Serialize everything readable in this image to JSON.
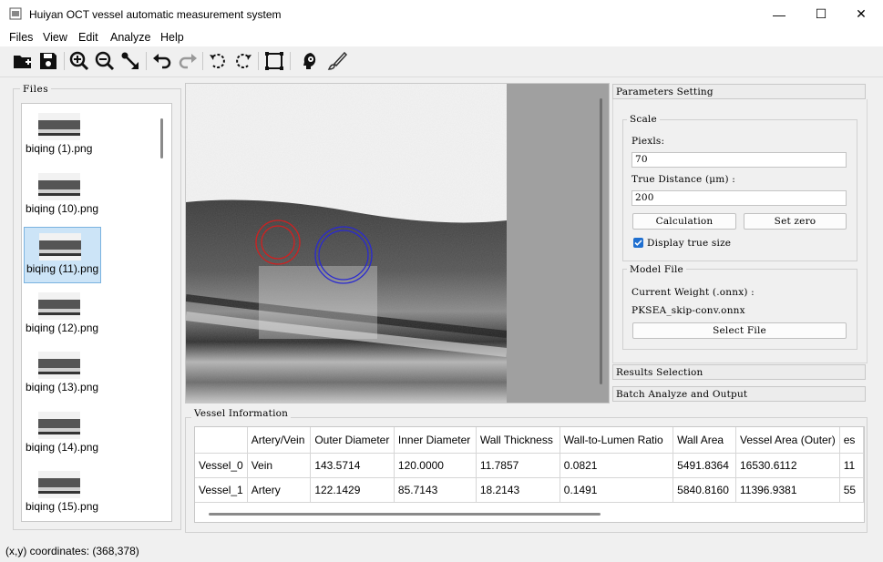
{
  "app": {
    "title": "Huiyan OCT vessel automatic measurement system"
  },
  "window_controls": {
    "minimize": "—",
    "maximize": "☐",
    "close": "✕"
  },
  "menu": [
    "Files",
    "View",
    "Edit",
    "Analyze",
    "Help"
  ],
  "toolbar": [
    "open-folder-icon",
    "save-icon",
    "zoom-in-icon",
    "zoom-out-icon",
    "measure-icon",
    "undo-icon",
    "redo-icon",
    "rotate-left-icon",
    "rotate-right-icon",
    "crop-icon",
    "ai-head-icon",
    "brush-icon"
  ],
  "files": {
    "title": "Files",
    "items": [
      {
        "label": "biqing (1).png"
      },
      {
        "label": "biqing (10).png"
      },
      {
        "label": "biqing (11).png"
      },
      {
        "label": "biqing (12).png"
      },
      {
        "label": "biqing (13).png"
      },
      {
        "label": "biqing (14).png"
      },
      {
        "label": "biqing (15).png"
      }
    ],
    "selected_index": 2
  },
  "params": {
    "header": "Parameters Setting",
    "scale_title": "Scale",
    "pixels_label": "Piexls:",
    "pixels_value": "70",
    "true_distance_label": "True Distance (μm) :",
    "true_distance_value": "200",
    "calc_button": "Calculation",
    "zero_button": "Set zero",
    "display_true_size": "Display true size",
    "display_true_size_checked": true,
    "model_title": "Model File",
    "current_weight_label": "Current Weight (.onnx) :",
    "current_weight_value": "PKSEA_skip-conv.onnx",
    "select_file_button": "Select File",
    "results_selection": "Results Selection",
    "batch": "Batch Analyze and Output"
  },
  "vessel": {
    "title": "Vessel Information",
    "columns": [
      "",
      "Artery/Vein",
      "Outer Diameter",
      "Inner Diameter",
      "Wall Thickness",
      "Wall-to-Lumen Ratio",
      "Wall Area",
      "Vessel Area (Outer)",
      "es"
    ],
    "rows": [
      [
        "Vessel_0",
        "Vein",
        "143.5714",
        "120.0000",
        "11.7857",
        "0.0821",
        "5491.8364",
        "16530.6112",
        "11"
      ],
      [
        "Vessel_1",
        "Artery",
        "122.1429",
        "85.7143",
        "18.2143",
        "0.1491",
        "5840.8160",
        "11396.9381",
        "55"
      ]
    ]
  },
  "status": {
    "coords": "(x,y) coordinates: (368,378)"
  },
  "colors": {
    "vein_circle": "#2a2ad0",
    "artery_circle": "#d02020",
    "accent": "#1f6fd0",
    "selection": "#cce4f7"
  }
}
